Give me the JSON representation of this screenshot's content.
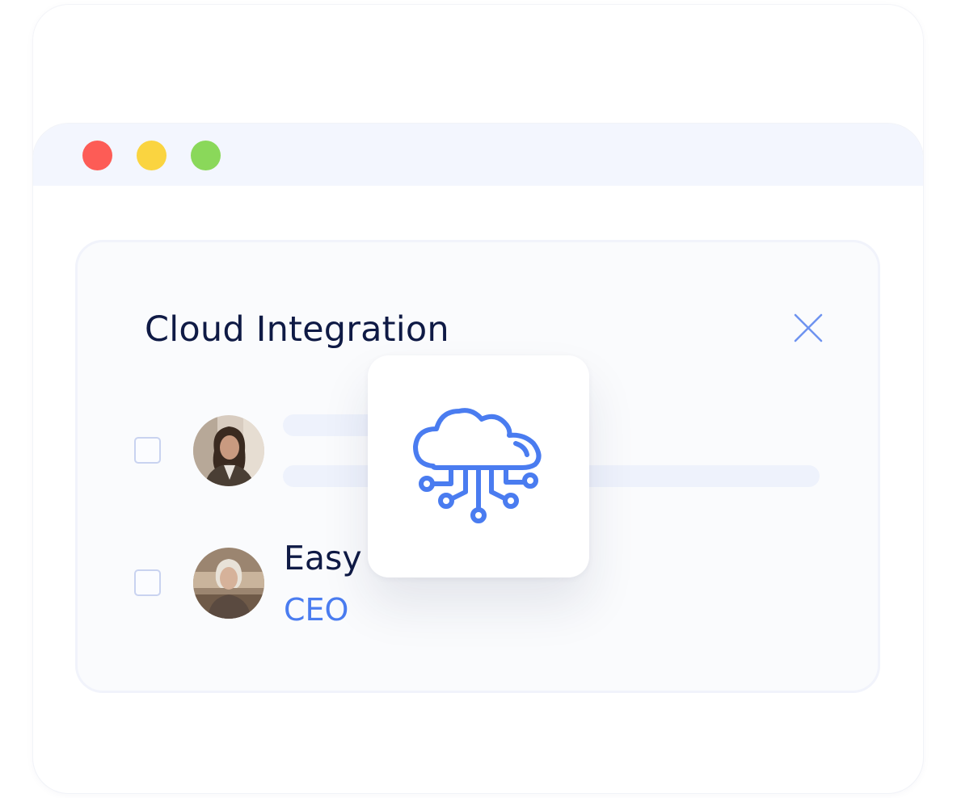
{
  "window": {
    "controls": [
      {
        "name": "close",
        "color": "#fd5c56"
      },
      {
        "name": "minimize",
        "color": "#fad440"
      },
      {
        "name": "maximize",
        "color": "#8ad85a"
      }
    ]
  },
  "panel": {
    "title": "Cloud Integration",
    "close_icon": "close-icon"
  },
  "rows": [
    {
      "checked": false,
      "avatar": "avatar-woman-dark-hair",
      "name": "",
      "role": ""
    },
    {
      "checked": false,
      "avatar": "avatar-woman-blonde",
      "name": "Easy",
      "role": "CEO"
    }
  ],
  "feature": {
    "icon": "cloud-circuit-icon"
  },
  "colors": {
    "title": "#0f1a45",
    "accent": "#4a7cf0",
    "titlebar": "#f3f6fe"
  }
}
